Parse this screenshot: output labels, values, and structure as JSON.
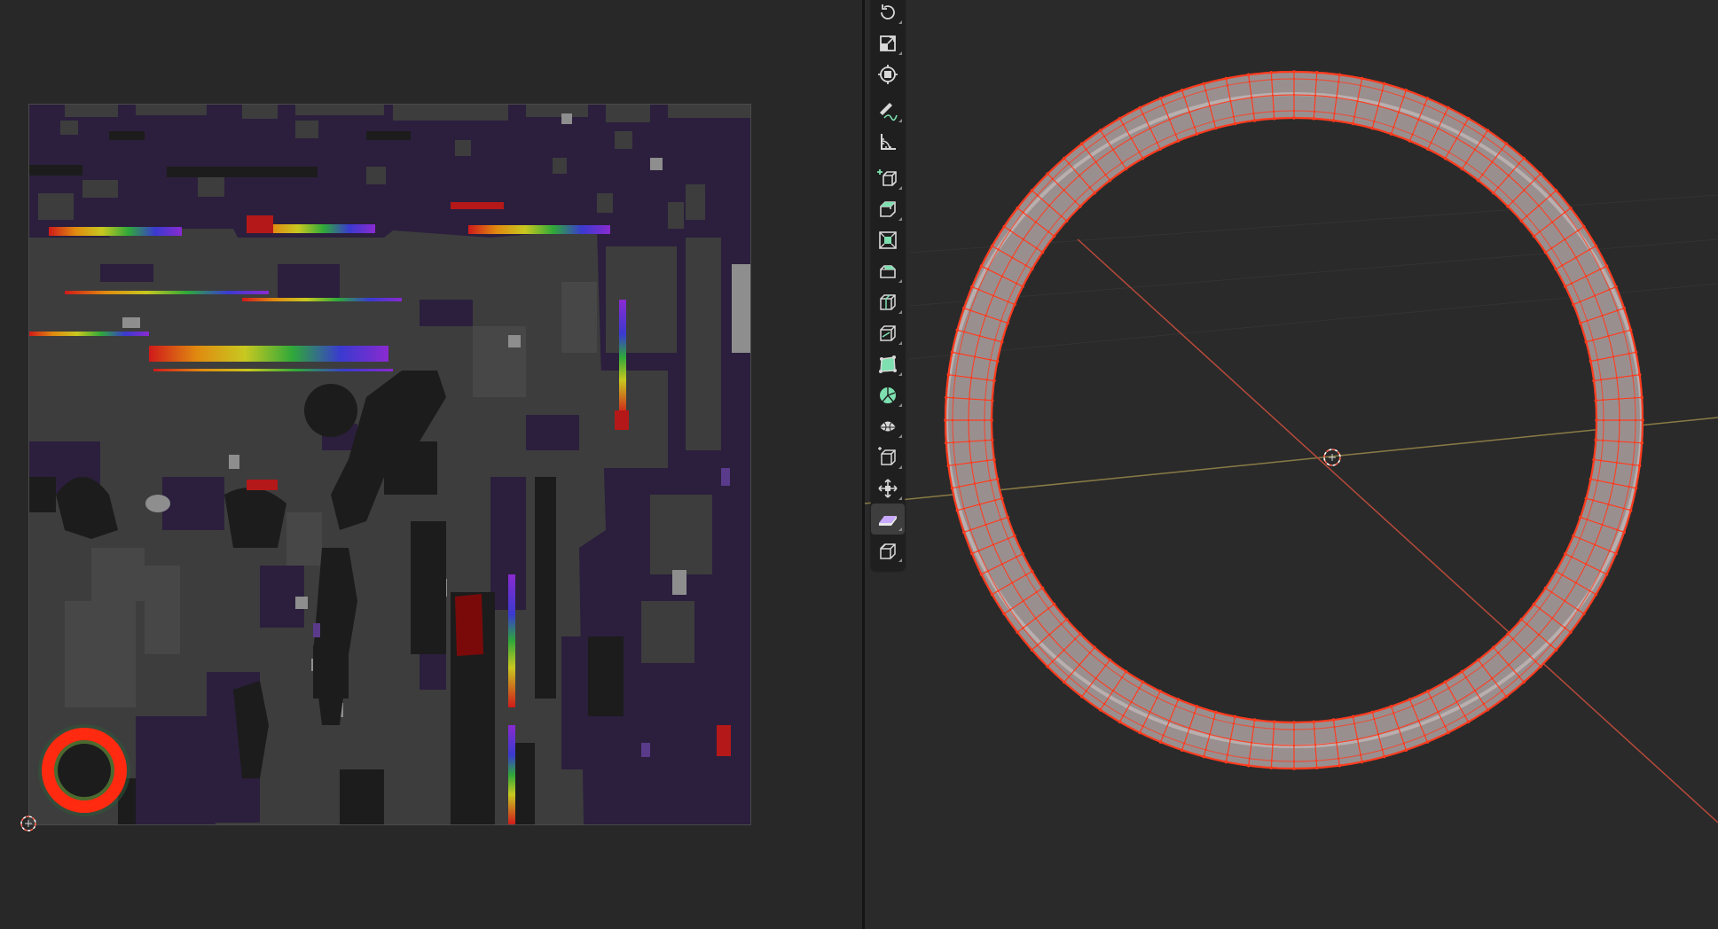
{
  "colors": {
    "editor_bg": "#282828",
    "uv_background": "#2b1f3d",
    "island_gray": "#3d3d3d",
    "island_dark": "#1c1c1c",
    "island_light": "#8e8e8e",
    "uv_seam_red": "#ff2a10",
    "mesh_red": "#ff3b1e",
    "axis_x": "#b84a3a",
    "axis_y": "#8a7b46",
    "toolbar_bg": "#1f1f1f",
    "tool_icon": "#d8d8d8",
    "tool_icon_green": "#7ee0b0",
    "tool_icon_purple": "#c7a9ff"
  },
  "uv_editor": {
    "cursor_icon": "2d-cursor-icon"
  },
  "viewport": {
    "origin_icon": "3d-cursor-icon",
    "tools": [
      {
        "name": "rotate-tool",
        "icon": "rotate-icon"
      },
      {
        "name": "scale-tool",
        "icon": "scale-icon"
      },
      {
        "name": "transform-tool",
        "icon": "transform-icon"
      },
      {
        "name": "annotate-tool",
        "icon": "annotate-icon"
      },
      {
        "name": "measure-tool",
        "icon": "measure-icon"
      },
      {
        "name": "add-cube-tool",
        "icon": "add-cube-icon"
      },
      {
        "name": "extrude-region-tool",
        "icon": "extrude-icon"
      },
      {
        "name": "inset-faces-tool",
        "icon": "inset-icon"
      },
      {
        "name": "bevel-tool",
        "icon": "bevel-icon"
      },
      {
        "name": "loop-cut-tool",
        "icon": "loop-cut-icon"
      },
      {
        "name": "knife-tool",
        "icon": "knife-icon"
      },
      {
        "name": "poly-build-tool",
        "icon": "poly-build-icon"
      },
      {
        "name": "spin-tool",
        "icon": "spin-icon"
      },
      {
        "name": "smooth-tool",
        "icon": "smooth-icon"
      },
      {
        "name": "edge-slide-tool",
        "icon": "edge-slide-icon"
      },
      {
        "name": "shrink-fatten-tool",
        "icon": "shrink-fatten-icon"
      },
      {
        "name": "shear-tool",
        "icon": "shear-icon"
      },
      {
        "name": "rip-region-tool",
        "icon": "rip-icon"
      }
    ]
  }
}
